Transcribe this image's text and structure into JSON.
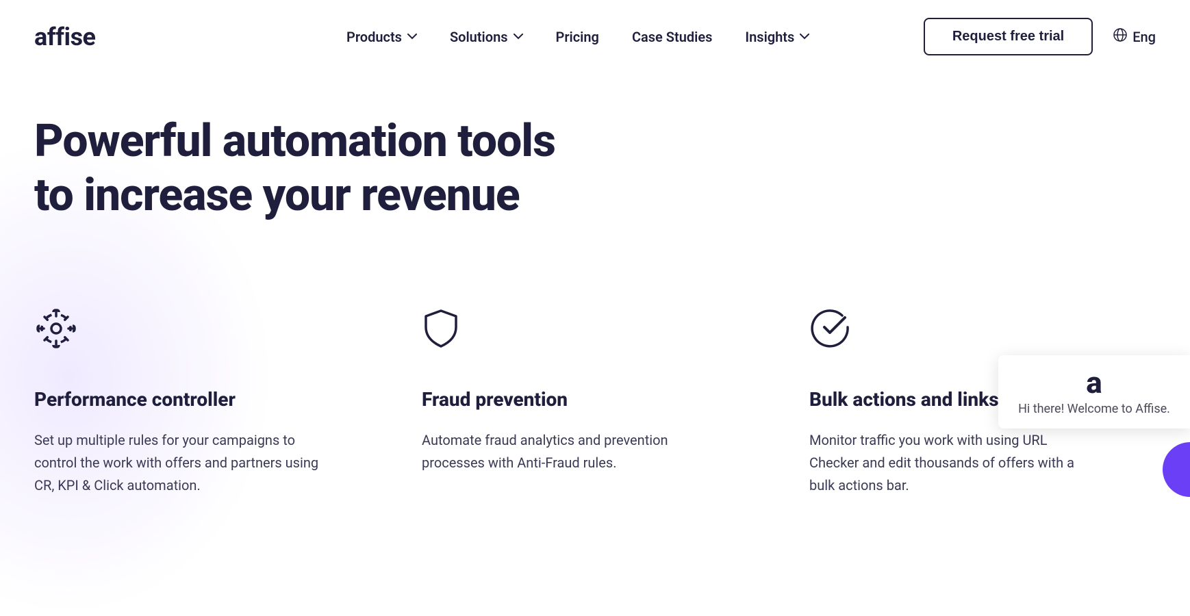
{
  "brand": {
    "logo_text": "affise"
  },
  "nav": {
    "items": [
      {
        "label": "Products",
        "has_dropdown": true
      },
      {
        "label": "Solutions",
        "has_dropdown": true
      },
      {
        "label": "Pricing",
        "has_dropdown": false
      },
      {
        "label": "Case Studies",
        "has_dropdown": false
      },
      {
        "label": "Insights",
        "has_dropdown": true
      }
    ],
    "trial_button": "Request free trial",
    "language": "Eng"
  },
  "hero": {
    "title_line1": "Powerful automation tools",
    "title_line2": "to increase your revenue"
  },
  "features": [
    {
      "icon": "gear-icon",
      "title": "Performance controller",
      "description": "Set up multiple rules for your campaigns to control the work with offers and partners using CR, KPI & Click automation."
    },
    {
      "icon": "shield-icon",
      "title": "Fraud prevention",
      "description": "Automate fraud analytics and prevention processes with Anti-Fraud rules."
    },
    {
      "icon": "check-circle-icon",
      "title": "Bulk actions and links checker",
      "description": "Monitor traffic you work with using URL Checker and edit thousands of offers with a bulk actions bar."
    }
  ],
  "chat": {
    "logo": "a",
    "greeting": "Hi there! Welcome to Affise."
  }
}
